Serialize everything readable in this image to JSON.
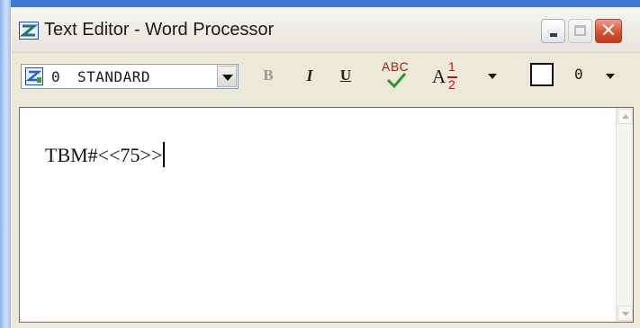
{
  "window": {
    "title": "Text Editor - Word Processor",
    "accent": "#3d7ad8",
    "close_color": "#d9502f"
  },
  "toolbar": {
    "style_number": "0",
    "style_name": "STANDARD",
    "bold_label": "B",
    "italic_label": "I",
    "underline_label": "U",
    "spell_label": "ABC",
    "fraction": {
      "base": "A",
      "numerator": "1",
      "denominator": "2"
    },
    "value_number": "0",
    "icons": [
      "style-icon",
      "dropdown-arrow-icon",
      "spell-check-icon",
      "fraction-icon",
      "color-box-icon"
    ]
  },
  "editor": {
    "content": "TBM#<<75>>"
  }
}
